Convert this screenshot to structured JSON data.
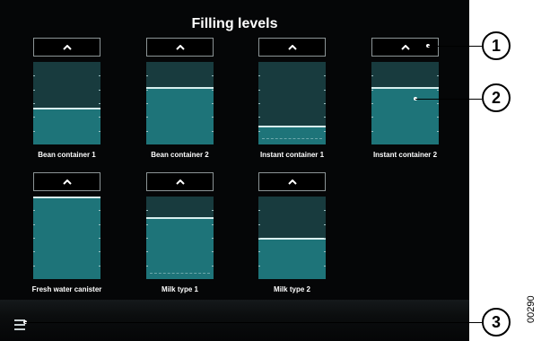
{
  "title": "Filling levels",
  "containers": [
    {
      "label": "Bean container 1",
      "level": 0.45
    },
    {
      "label": "Bean container 2",
      "level": 0.7
    },
    {
      "label": "Instant container 1",
      "level": 0.23
    },
    {
      "label": "Instant container 2",
      "level": 0.7
    },
    {
      "label": "Fresh water canister",
      "level": 1.0
    },
    {
      "label": "Milk type 1",
      "level": 0.75
    },
    {
      "label": "Milk type 2",
      "level": 0.5
    }
  ],
  "icons": {
    "up_button": "chevron-up-icon",
    "menu": "hamburger-menu-icon"
  },
  "callouts": [
    "1",
    "2",
    "3"
  ],
  "figure_id": "00290",
  "colors": {
    "screen_bg": "#050607",
    "empty": "#183b3e",
    "fill": "#1e7479",
    "level_line": "#d8eeee"
  }
}
